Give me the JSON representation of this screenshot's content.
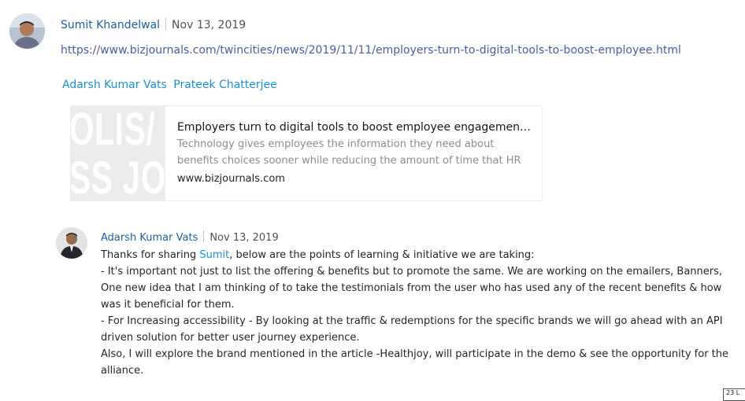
{
  "post": {
    "author": "Sumit Khandelwal",
    "date": "Nov 13, 2019",
    "link": "https://www.bizjournals.com/twincities/news/2019/11/11/employers-turn-to-digital-tools-to-boost-employee.html",
    "mentions": [
      "Adarsh Kumar Vats",
      "Prateek Chatterjee"
    ]
  },
  "preview": {
    "thumb_line1": "OLIS/",
    "thumb_line2": "SS JO",
    "title": "Employers turn to digital tools to boost employee engagement w...",
    "description": "Technology gives employees the information they need about benefits choices sooner while reducing the amount of time that HR",
    "domain": "www.bizjournals.com"
  },
  "reply": {
    "author": "Adarsh Kumar Vats",
    "date": "Nov 13, 2019",
    "intro_before": "Thanks for sharing ",
    "intro_mention": "Sumit",
    "intro_after": ", below are the points of learning & initiative we are taking:",
    "paragraphs": [
      "- It's important not just to list the offering & benefits but to promote the same. We are working on the emailers, Banners, One new idea that I am thinking of to take the testimonials from the user who has used any of the recent benefits & how was it beneficial for them.",
      "- For Increasing accessibility - By looking at the traffic & redemptions for the specific brands we will go ahead with an API driven solution for better user journey experience.",
      "Also, I will explore the brand mentioned in the article -Healthjoy, will participate in the demo & see the opportunity for the alliance."
    ]
  },
  "badge": "23 L"
}
